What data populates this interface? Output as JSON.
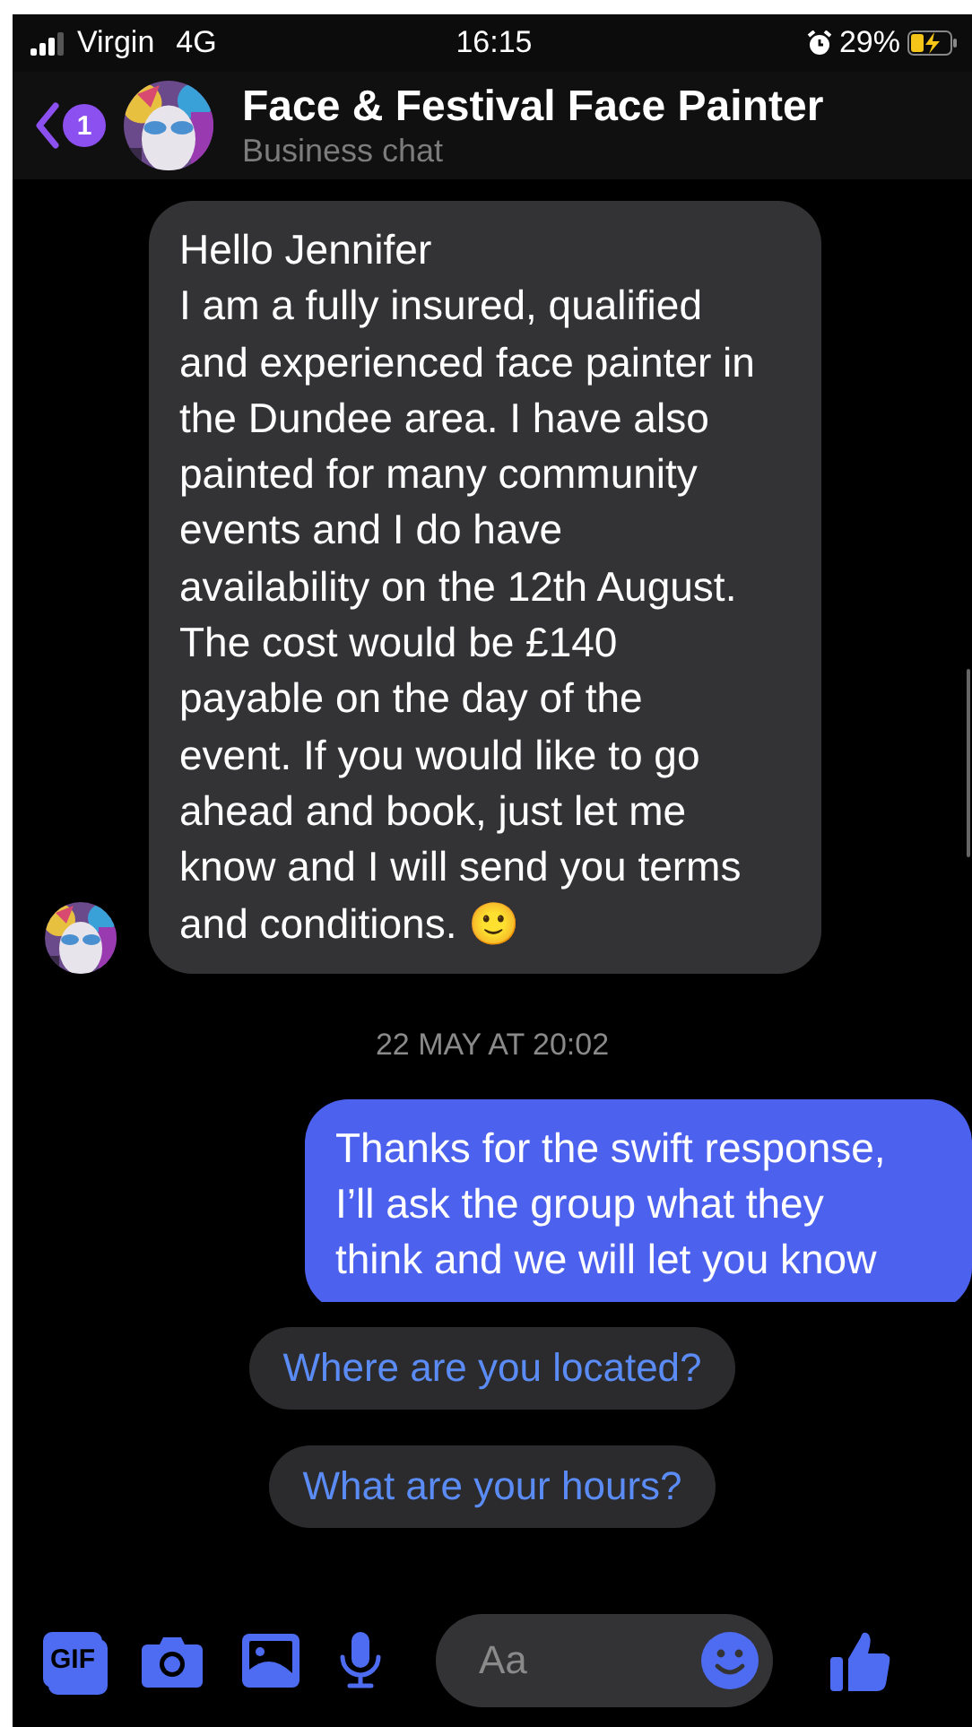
{
  "status_bar": {
    "carrier": "Virgin",
    "network": "4G",
    "time": "16:15",
    "battery": "29%"
  },
  "header": {
    "back_badge": "1",
    "title": "Face & Festival Face Painter",
    "subtitle": "Business chat"
  },
  "messages": [
    {
      "kind": "incoming",
      "text": "Hello Jennifer\nI am a fully insured, qualified and experienced face painter in the Dundee area. I have also painted for many community events and I do have availability on the 12th August. The cost would be £140 payable on the day of the event. If you would like to go ahead and book, just let me know and I will send you terms and conditions. 🙂"
    },
    {
      "kind": "timestamp",
      "text": "22 MAY AT 20:02"
    },
    {
      "kind": "outgoing",
      "text": "Thanks for the swift response, I’ll ask the group what they think and we will let you know"
    }
  ],
  "quick_replies": [
    "Where are you located?",
    "What are your hours?"
  ],
  "composer": {
    "gif_label": "GIF",
    "placeholder": "Aa"
  }
}
